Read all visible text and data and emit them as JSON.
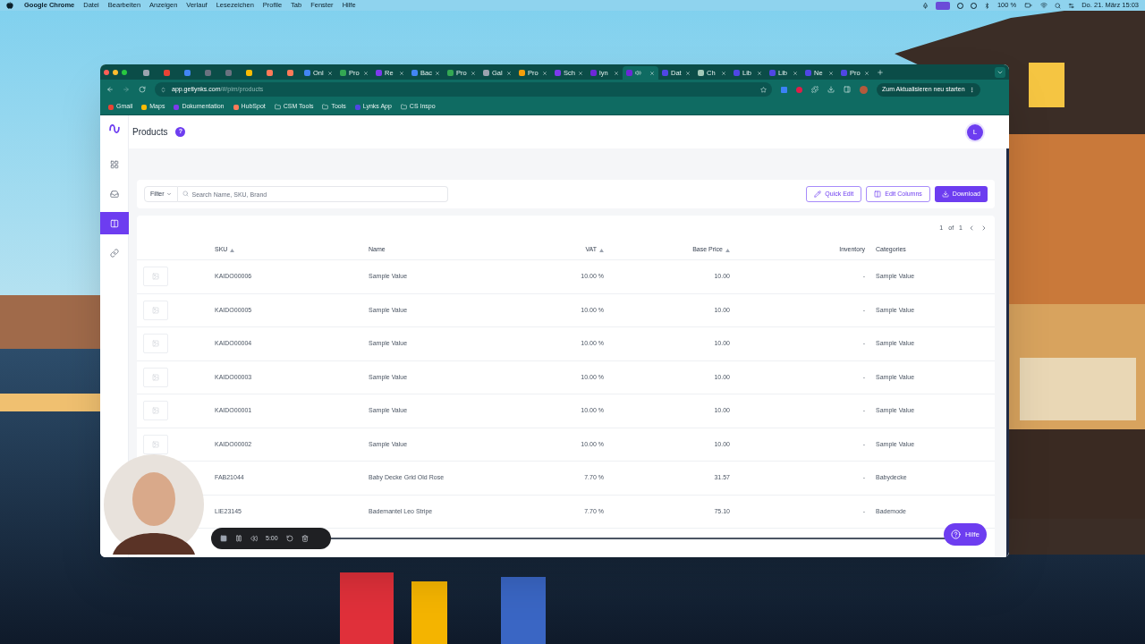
{
  "menubar": {
    "app_name": "Google Chrome",
    "menus": [
      "Datei",
      "Bearbeiten",
      "Anzeigen",
      "Verlauf",
      "Lesezeichen",
      "Profile",
      "Tab",
      "Fenster",
      "Hilfe"
    ],
    "battery": "100 %",
    "clock": "Do. 21. März 15:03"
  },
  "browser": {
    "tabs": [
      {
        "kind": "pinned",
        "selected": false,
        "color": "#9ca3af"
      },
      {
        "kind": "pinned",
        "selected": false,
        "color": "#ea4335"
      },
      {
        "kind": "pinned",
        "selected": false,
        "color": "#4285f4"
      },
      {
        "kind": "pinned",
        "selected": false,
        "color": "#6b7280"
      },
      {
        "kind": "pinned",
        "selected": false,
        "color": "#6b7280"
      },
      {
        "kind": "pinned",
        "selected": false,
        "color": "#fbbc04"
      },
      {
        "kind": "pinned",
        "selected": false,
        "color": "#ff7a59"
      },
      {
        "kind": "pinned",
        "selected": false,
        "color": "#ff7a59"
      },
      {
        "kind": "page",
        "title": "Onl",
        "selected": false,
        "color": "#4285f4"
      },
      {
        "kind": "page",
        "title": "Pro",
        "selected": false,
        "color": "#34a853"
      },
      {
        "kind": "page",
        "title": "Re",
        "selected": false,
        "color": "#7c3aed"
      },
      {
        "kind": "page",
        "title": "Bac",
        "selected": false,
        "color": "#4285f4"
      },
      {
        "kind": "page",
        "title": "Pro",
        "selected": false,
        "color": "#34a853"
      },
      {
        "kind": "page",
        "title": "Gal",
        "selected": false,
        "color": "#9ca3af"
      },
      {
        "kind": "page",
        "title": "Pro",
        "selected": false,
        "color": "#f59e0b"
      },
      {
        "kind": "page",
        "title": "Sch",
        "selected": false,
        "color": "#7c3aed"
      },
      {
        "kind": "page",
        "title": "lyn",
        "selected": false,
        "color": "#6d28d9"
      },
      {
        "kind": "page",
        "selected": true,
        "color": "#6d28d9"
      },
      {
        "kind": "page",
        "title": "Dat",
        "selected": false,
        "color": "#4f46e5"
      },
      {
        "kind": "page",
        "title": "Ch",
        "selected": false,
        "color": "#a3c9b8"
      },
      {
        "kind": "page",
        "title": "Lib",
        "selected": false,
        "color": "#4f46e5"
      },
      {
        "kind": "page",
        "title": "Lib",
        "selected": false,
        "color": "#4f46e5"
      },
      {
        "kind": "page",
        "title": "Ne",
        "selected": false,
        "color": "#4f46e5"
      },
      {
        "kind": "page",
        "title": "Pro",
        "selected": false,
        "color": "#4f46e5"
      }
    ],
    "url_host": "app.getlynks.com",
    "url_path": "/#/pim/products",
    "update_button": "Zum Aktualisieren neu starten",
    "bookmarks": [
      {
        "kind": "site",
        "label": "Gmail",
        "color": "#ea4335"
      },
      {
        "kind": "site",
        "label": "Maps",
        "color": "#fbbc04"
      },
      {
        "kind": "site",
        "label": "Dokumentation",
        "color": "#7c3aed"
      },
      {
        "kind": "site",
        "label": "HubSpot",
        "color": "#ff7a59"
      },
      {
        "kind": "folder",
        "label": "CSM Tools"
      },
      {
        "kind": "folder",
        "label": "Tools"
      },
      {
        "kind": "site",
        "label": "Lynks App",
        "color": "#4f46e5"
      },
      {
        "kind": "folder",
        "label": "CS Inspo"
      }
    ]
  },
  "app": {
    "page_title": "Products",
    "help_mark": "?",
    "avatar": "L",
    "nav": [
      {
        "kind": "grid",
        "selected": false
      },
      {
        "kind": "inbox",
        "selected": false
      },
      {
        "kind": "columns",
        "selected": true
      },
      {
        "kind": "link",
        "selected": false
      }
    ],
    "filter": "Filter",
    "search_placeholder": "Search Name, SKU, Brand",
    "buttons": [
      {
        "kind": "edit",
        "label": "Quick Edit"
      },
      {
        "kind": "columns",
        "label": "Edit Columns"
      },
      {
        "kind": "download",
        "label": "Download"
      }
    ],
    "pagination": {
      "page": "1",
      "of": "of",
      "total": "1"
    },
    "columns": [
      {
        "label": "SKU",
        "sortable": true
      },
      {
        "label": "Name",
        "sortable": false
      },
      {
        "label": "VAT",
        "sortable": true
      },
      {
        "label": "Base Price",
        "sortable": true
      },
      {
        "label": "Inventory",
        "sortable": false
      },
      {
        "label": "Categories",
        "sortable": false
      }
    ],
    "rows": [
      {
        "sku": "KAIDO00006",
        "name": "Sample Value",
        "vat": "10.00 %",
        "price": "10.00",
        "inventory": "-",
        "category": "Sample Value"
      },
      {
        "sku": "KAIDO00005",
        "name": "Sample Value",
        "vat": "10.00 %",
        "price": "10.00",
        "inventory": "-",
        "category": "Sample Value"
      },
      {
        "sku": "KAIDO00004",
        "name": "Sample Value",
        "vat": "10.00 %",
        "price": "10.00",
        "inventory": "-",
        "category": "Sample Value"
      },
      {
        "sku": "KAIDO00003",
        "name": "Sample Value",
        "vat": "10.00 %",
        "price": "10.00",
        "inventory": "-",
        "category": "Sample Value"
      },
      {
        "sku": "KAIDO00001",
        "name": "Sample Value",
        "vat": "10.00 %",
        "price": "10.00",
        "inventory": "-",
        "category": "Sample Value"
      },
      {
        "sku": "KAIDO00002",
        "name": "Sample Value",
        "vat": "10.00 %",
        "price": "10.00",
        "inventory": "-",
        "category": "Sample Value"
      },
      {
        "sku": "FAB21044",
        "name": "Baby Decke Grid Old Rose",
        "vat": "7.70 %",
        "price": "31.57",
        "inventory": "-",
        "category": "Babydecke"
      },
      {
        "sku": "LIE23145",
        "name": "Bademantel Leo Stripe",
        "vat": "7.70 %",
        "price": "75.10",
        "inventory": "-",
        "category": "Bademode"
      }
    ],
    "help_button": "Hilfe"
  },
  "recorder": {
    "time": "5:00"
  }
}
